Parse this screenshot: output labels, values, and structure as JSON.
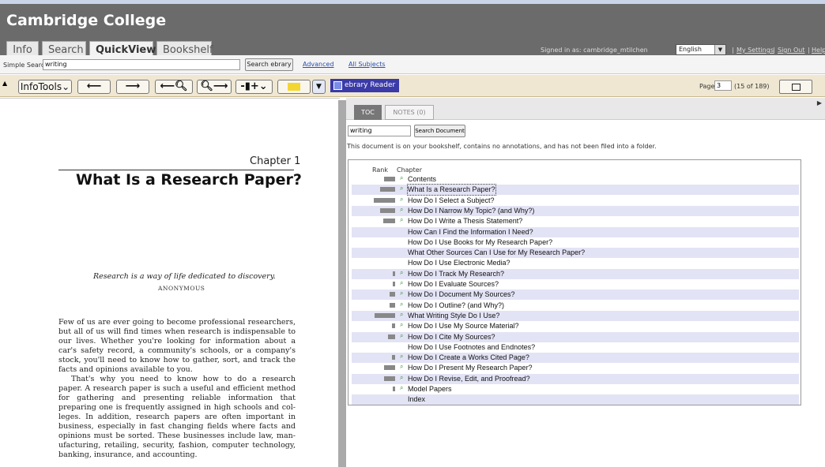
{
  "header": {
    "title": "Cambridge College",
    "tabs": [
      {
        "label": "Info"
      },
      {
        "label": "Search"
      },
      {
        "label": "QuickView"
      },
      {
        "label": "Bookshelf"
      }
    ],
    "signed_in": "Signed in as: cambridge_mtilchen",
    "language": "English",
    "links": [
      "My Settings",
      "Sign Out",
      "Help"
    ]
  },
  "searchbar": {
    "label": "Simple Search:",
    "value": "writing",
    "button": "Search ebrary",
    "advanced": "Advanced",
    "all_subjects": "All Subjects"
  },
  "toolbar": {
    "infotools": "InfoTools",
    "reader": "ebrary Reader",
    "page_label": "Page",
    "page_value": "3",
    "page_of": "(15 of 189)"
  },
  "document": {
    "chapter": "Chapter 1",
    "title": "What Is a Research Paper?",
    "epigraph": "Research is a way of life dedicated to discovery.",
    "epigraph_source": "ANONYMOUS",
    "lines": [
      "Few of us are ever going to become professional researchers,",
      "but all of us will find times when research is indispensable to",
      "our lives. Whether you're looking for information about a",
      "car's safety record, a community's schools, or a company's",
      "stock, you'll need to know how to gather, sort, and track the",
      "facts and opinions available to you.",
      "That's why you need to know how to do a research",
      "paper. A research paper is such a useful and efficient method",
      "for gathering and presenting reliable information that",
      "preparing one is frequently assigned in high schools and col-",
      "leges. In addition, research papers are often important in",
      "business, especially in fast changing fields where facts and",
      "opinions must be sorted. These businesses include law, man-",
      "ufacturing, retailing, security, fashion, computer technology,",
      "banking, insurance, and accounting."
    ]
  },
  "panel": {
    "toc_tab": "TOC",
    "notes_tab": "NOTES (0)",
    "search_value": "writing",
    "search_button": "Search Document",
    "status": "This document is on your bookshelf, contains no annotations, and has not been filed into a folder.",
    "rank_header": "Rank",
    "chapter_header": "Chapter",
    "toc": [
      {
        "title": "Contents",
        "rank": 0.4,
        "icon": true
      },
      {
        "title": "What Is a Research Paper?",
        "rank": 0.55,
        "icon": true,
        "selected": true
      },
      {
        "title": "How Do I Select a Subject?",
        "rank": 0.8,
        "icon": true
      },
      {
        "title": "How Do I Narrow My Topic? (and Why?)",
        "rank": 0.55,
        "icon": true
      },
      {
        "title": "How Do I Write a Thesis Statement?",
        "rank": 0.45,
        "icon": true
      },
      {
        "title": "How Can I Find the Information I Need?",
        "rank": 0,
        "icon": false
      },
      {
        "title": "How Do I Use Books for My Research Paper?",
        "rank": 0,
        "icon": false
      },
      {
        "title": "What Other Sources Can I Use for My Research Paper?",
        "rank": 0,
        "icon": false
      },
      {
        "title": "How Do I Use Electronic Media?",
        "rank": 0,
        "icon": false
      },
      {
        "title": "How Do I Track My Research?",
        "rank": 0.1,
        "icon": true
      },
      {
        "title": "How Do I Evaluate Sources?",
        "rank": 0.08,
        "icon": true
      },
      {
        "title": "How Do I Document My Sources?",
        "rank": 0.2,
        "icon": true
      },
      {
        "title": "How Do I Outline? (and Why?)",
        "rank": 0.2,
        "icon": true
      },
      {
        "title": "What Writing Style Do I Use?",
        "rank": 0.75,
        "icon": true
      },
      {
        "title": "How Do I Use My Source Material?",
        "rank": 0.12,
        "icon": true
      },
      {
        "title": "How Do I Cite My Sources?",
        "rank": 0.25,
        "icon": true
      },
      {
        "title": "How Do I Use Footnotes and Endnotes?",
        "rank": 0,
        "icon": false
      },
      {
        "title": "How Do I Create a Works Cited Page?",
        "rank": 0.12,
        "icon": true
      },
      {
        "title": "How Do I Present My Research Paper?",
        "rank": 0.4,
        "icon": true
      },
      {
        "title": "How Do I Revise, Edit, and Proofread?",
        "rank": 0.4,
        "icon": true
      },
      {
        "title": "Model Papers",
        "rank": 0.08,
        "icon": true
      },
      {
        "title": "Index",
        "rank": 0,
        "icon": false
      }
    ]
  }
}
